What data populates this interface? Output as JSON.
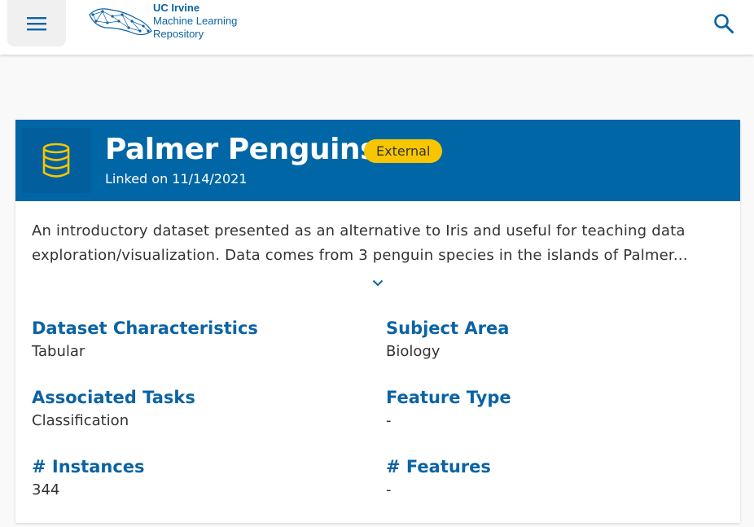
{
  "header": {
    "logo": {
      "line1": "UC Irvine",
      "line2": "Machine Learning",
      "line3": "Repository"
    },
    "menu_icon": "hamburger-menu-icon",
    "search_icon": "search-icon"
  },
  "dataset": {
    "title": "Palmer Penguins",
    "badge": "External",
    "linked": "Linked on 11/14/2021",
    "icon": "database-icon",
    "description_lines": [
      "An introductory dataset presented as an alternative to Iris and useful for teaching data",
      "exploration/visualization. Data comes from 3 penguin species in the islands of Palmer..."
    ],
    "expand_icon": "chevron-down-icon"
  },
  "properties": [
    {
      "label": "Dataset Characteristics",
      "value": "Tabular"
    },
    {
      "label": "Subject Area",
      "value": "Biology"
    },
    {
      "label": "Associated Tasks",
      "value": "Classification"
    },
    {
      "label": "Feature Type",
      "value": "-"
    },
    {
      "label": "# Instances",
      "value": "344"
    },
    {
      "label": "# Features",
      "value": "-"
    }
  ],
  "colors": {
    "primary": "#0066a6",
    "accent": "#0b63a3",
    "badge": "#f7c600",
    "icon": "#f7c600"
  }
}
